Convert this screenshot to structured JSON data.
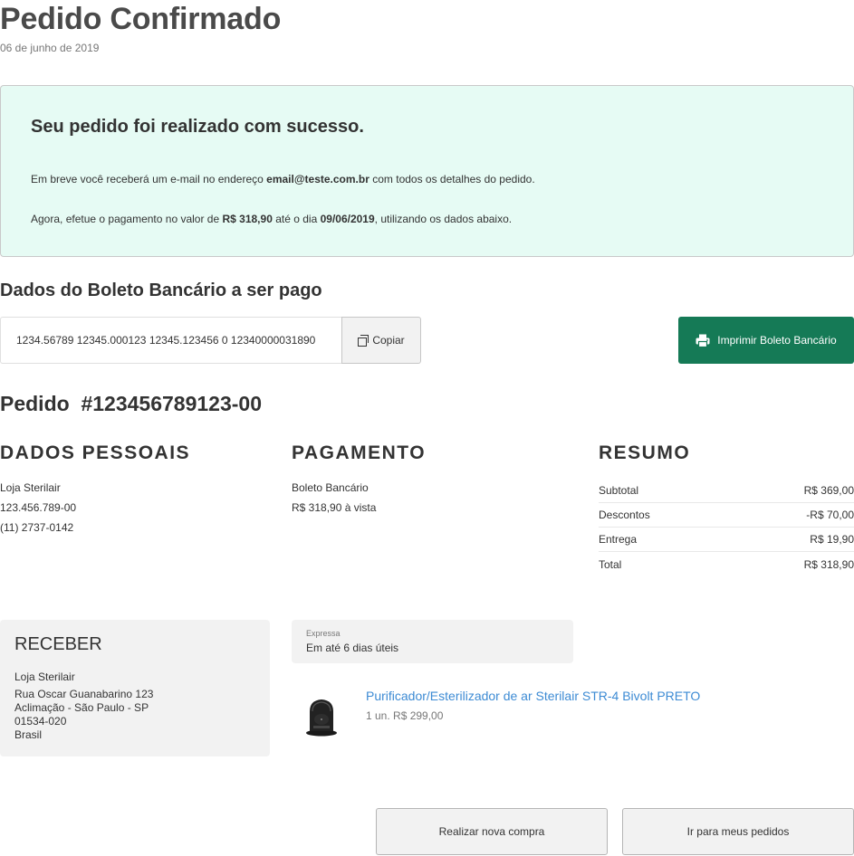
{
  "header": {
    "title": "Pedido Confirmado",
    "date": "06 de junho de 2019"
  },
  "success": {
    "title": "Seu pedido foi realizado com sucesso.",
    "line1_prefix": "Em breve você receberá um e-mail no endereço ",
    "line1_email": "email@teste.com.br",
    "line1_suffix": " com todos os detalhes do pedido.",
    "line2_prefix": "Agora, efetue o pagamento no valor de ",
    "line2_amount": "R$ 318,90",
    "line2_mid": " até o dia ",
    "line2_date": "09/06/2019",
    "line2_suffix": ", utilizando os dados abaixo."
  },
  "boleto": {
    "heading": "Dados do Boleto Bancário a ser pago",
    "code": "1234.56789 12345.000123 12345.123456 0 12340000031890",
    "copy_label": "Copiar",
    "print_label": "Imprimir Boleto Bancário"
  },
  "order": {
    "heading": "Pedido  #123456789123-00"
  },
  "personal": {
    "title": "DADOS PESSOAIS",
    "name": "Loja Sterilair",
    "document": "123.456.789-00",
    "phone": "(11) 2737-0142"
  },
  "payment": {
    "title": "PAGAMENTO",
    "method": "Boleto Bancário",
    "amount": "R$ 318,90 à vista"
  },
  "summary": {
    "title": "RESUMO",
    "rows": [
      {
        "label": "Subtotal",
        "value": "R$ 369,00"
      },
      {
        "label": "Descontos",
        "value": "-R$ 70,00"
      },
      {
        "label": "Entrega",
        "value": "R$ 19,90"
      },
      {
        "label": "Total",
        "value": "R$ 318,90"
      }
    ]
  },
  "receive": {
    "title": "RECEBER",
    "name": "Loja Sterilair",
    "street": "Rua Oscar Guanabarino 123",
    "district": "Aclimação - São Paulo - SP",
    "zip": "01534-020",
    "country": "Brasil"
  },
  "shipping": {
    "type": "Expressa",
    "time": "Em até 6 dias úteis"
  },
  "product": {
    "name": "Purificador/Esterilizador de ar Sterilair STR-4 Bivolt PRETO",
    "price": "1 un. R$ 299,00",
    "image_icon": "air-purifier-image"
  },
  "actions": {
    "new_purchase": "Realizar nova compra",
    "my_orders": "Ir para meus pedidos"
  },
  "colors": {
    "success_bg": "#e6fbf4",
    "primary_button": "#157a56",
    "link": "#3d8bd4"
  }
}
